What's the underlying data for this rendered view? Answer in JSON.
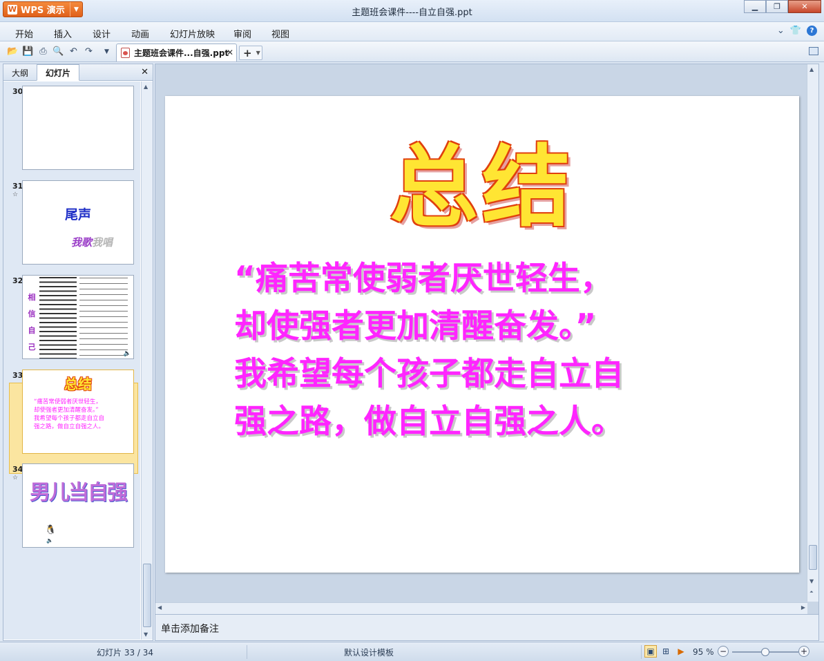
{
  "app": {
    "name": "WPS 演示",
    "window_title": "主题班会课件----自立自强.ppt"
  },
  "menu": [
    "开始",
    "插入",
    "设计",
    "动画",
    "幻灯片放映",
    "审阅",
    "视图"
  ],
  "toolbar": {
    "doc_tab_label": "主题班会课件...自强.ppt",
    "new_tab_label": "+"
  },
  "left_pane": {
    "tabs": [
      "大纲",
      "幻灯片"
    ],
    "active_tab": "幻灯片",
    "thumbnails": [
      {
        "number": "30",
        "starred": false,
        "content": []
      },
      {
        "number": "31",
        "starred": true,
        "title": "尾声",
        "subtitle_a": "我歌",
        "subtitle_b": "我唱"
      },
      {
        "number": "32",
        "starred": false,
        "side_chars": [
          "相",
          "信",
          "自",
          "己"
        ]
      },
      {
        "number": "33",
        "starred": false,
        "selected": true,
        "title": "总结",
        "lines": [
          "“痛苦常使弱者厌世轻生，",
          "却使强者更加清醒奋发。”",
          "我希望每个孩子都走自立自",
          "强之路，做自立自强之人。"
        ]
      },
      {
        "number": "34",
        "starred": true,
        "title": "男儿当自强"
      }
    ]
  },
  "slide": {
    "title": "总结",
    "body_lines": [
      "“痛苦常使弱者厌世轻生，",
      "却使强者更加清醒奋发。”",
      "我希望每个孩子都走自立自",
      "强之路，做自立自强之人。"
    ],
    "title_color": "#ffe533",
    "title_outline_color": "#e0400e",
    "body_color": "#ff25ff"
  },
  "notes_placeholder": "单击添加备注",
  "status": {
    "slide_counter": "幻灯片 33 / 34",
    "template": "默认设计模板",
    "zoom": "95 %",
    "zoom_fraction": 0.5
  }
}
